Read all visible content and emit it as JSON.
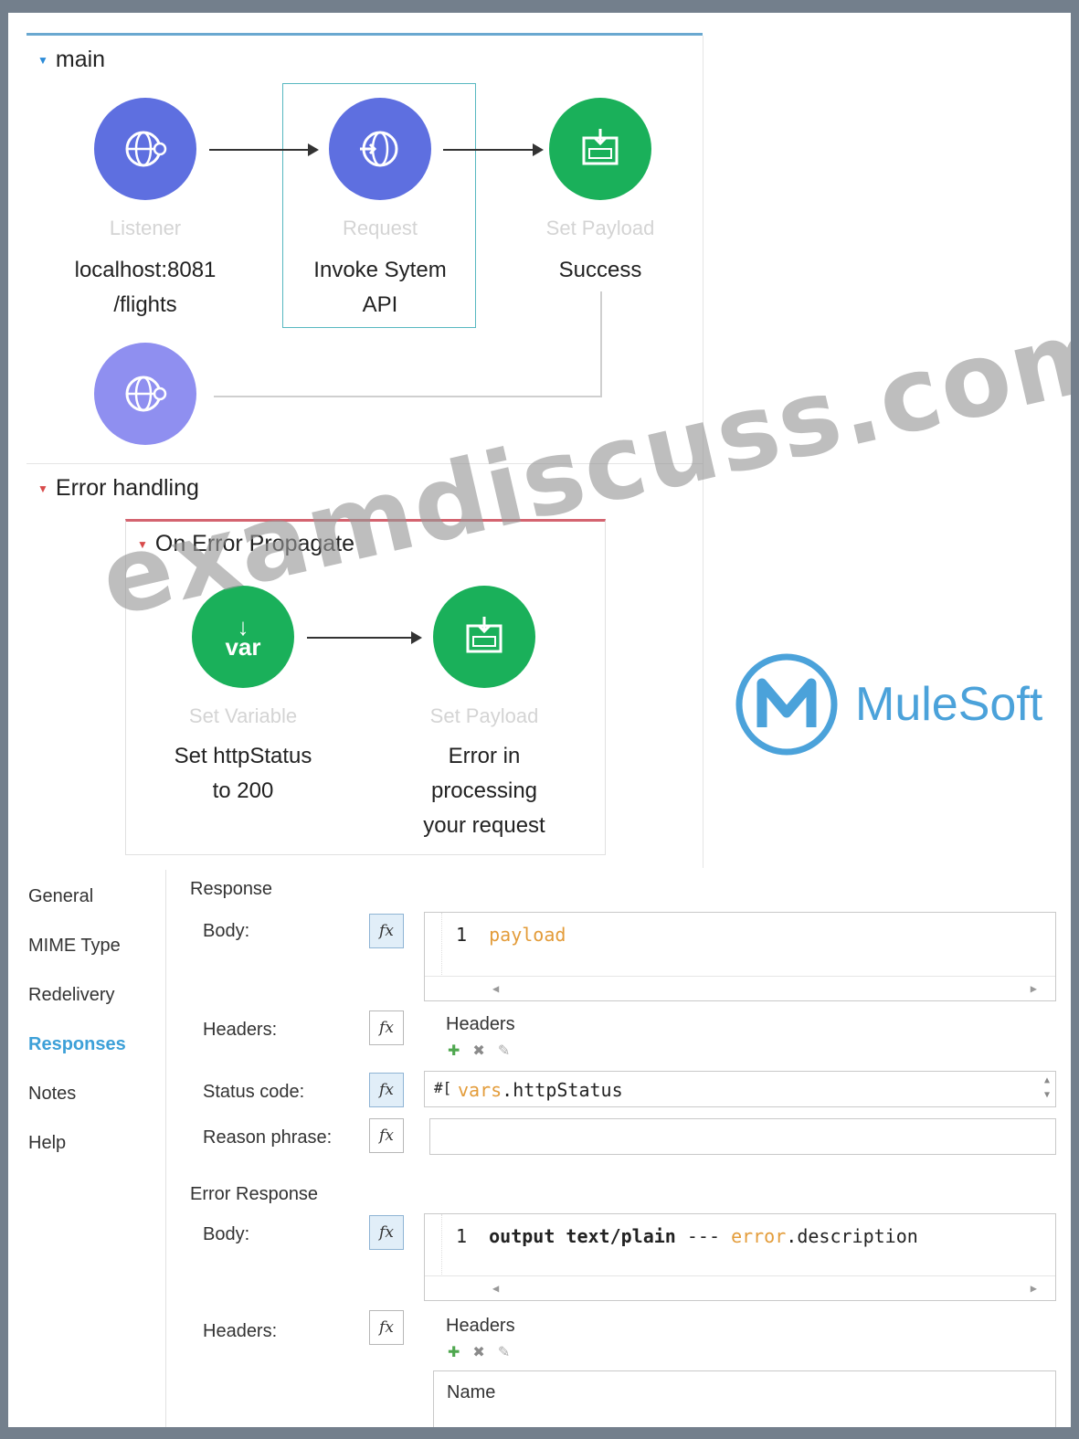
{
  "flow": {
    "main_title": "main",
    "nodes": [
      {
        "type": "Listener",
        "label_line1": "localhost:8081",
        "label_line2": "/flights"
      },
      {
        "type": "Request",
        "label_line1": "Invoke Sytem",
        "label_line2": "API"
      },
      {
        "type": "Set Payload",
        "label_line1": "Success",
        "label_line2": ""
      }
    ],
    "error_handling_title": "Error handling",
    "on_error_title": "On Error Propagate",
    "error_nodes": [
      {
        "type": "Set Variable",
        "label_line1": "Set httpStatus",
        "label_line2": "to 200",
        "label_line3": "",
        "icon_text": "var"
      },
      {
        "type": "Set Payload",
        "label_line1": "Error in",
        "label_line2": "processing",
        "label_line3": "your request"
      }
    ]
  },
  "nav": {
    "items": [
      "General",
      "MIME Type",
      "Redelivery",
      "Responses",
      "Notes",
      "Help"
    ],
    "active": "Responses"
  },
  "response": {
    "title": "Response",
    "body_label": "Body:",
    "body_line_no": "1",
    "body_code": "payload",
    "headers_label": "Headers:",
    "headers_title": "Headers",
    "status_label": "Status code:",
    "status_prefix": "#[",
    "status_var": "vars",
    "status_rest": ".httpStatus",
    "reason_label": "Reason phrase:",
    "reason_value": ""
  },
  "error_response": {
    "title": "Error Response",
    "body_label": "Body:",
    "body_line_no": "1",
    "body_code_kw": "output text/plain",
    "body_code_sep": " --- ",
    "body_code_var": "error",
    "body_code_rest": ".description",
    "headers_label": "Headers:",
    "headers_title": "Headers",
    "table_header": "Name"
  },
  "fx_label": "fx",
  "overlay": {
    "watermark": "examdiscuss.com",
    "logo_text": "MuleSoft"
  },
  "colors": {
    "connector_blue": "#5e6fe0",
    "connector_light": "#8f8ff0",
    "transformer_green": "#1ab05a",
    "accent": "#3da0d8",
    "error_red": "#d84b4b"
  }
}
